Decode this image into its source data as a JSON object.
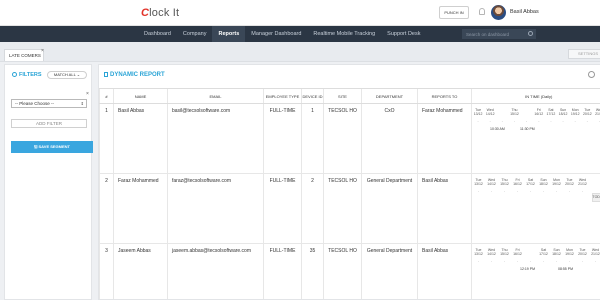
{
  "header": {
    "logo_c": "C",
    "logo_rest": "lock It",
    "punch_label": "PUNCH IN",
    "user_name": "Basil Abbas"
  },
  "nav": {
    "items": [
      {
        "label": "Dashboard"
      },
      {
        "label": "Company"
      },
      {
        "label": "Reports"
      },
      {
        "label": "Manager Dashboard"
      },
      {
        "label": "Realtime Mobile Tracking"
      },
      {
        "label": "Support Desk"
      }
    ],
    "active": "Reports",
    "search_placeholder": "Search on dashboard"
  },
  "tabs": {
    "late_comers": "LATE COMERS",
    "close": "×"
  },
  "filters": {
    "title": "FILTERS",
    "match": "MATCH ALL",
    "close": "×",
    "select_value": "-- Please Choose --",
    "add_filter": "ADD FILTER",
    "save_segment": "SAVE SEGMENT"
  },
  "report": {
    "title": "DYNAMIC REPORT",
    "columns": [
      "#",
      "NAME",
      "EMAIL",
      "EMPLOYEE TYPE",
      "DEVICE ID",
      "SITE",
      "DEPARTMENT",
      "REPORTS TO",
      "IN TIME (Daily)"
    ],
    "rows": [
      {
        "num": "1",
        "name": "Basil Abbas",
        "email": "basil@tecsolsoftware.com",
        "type": "FULL-TIME",
        "device": "1",
        "site": "TECSOL HO",
        "dept": "CxO",
        "reports_to": "Faraz Mohammed",
        "days1": [
          "Tue",
          "Wed",
          "",
          "Thu",
          "",
          "Fri",
          "Sat",
          "Sun",
          "Mon",
          "Tue",
          "Wed"
        ],
        "days2": [
          "13/12",
          "14/12",
          "",
          "15/12",
          "",
          "16/12",
          "17/12",
          "18/12",
          "19/12",
          "20/12",
          "21/12"
        ],
        "times": [
          "10:30 AM",
          "11:30 PM"
        ]
      },
      {
        "num": "2",
        "name": "Faraz Mohammed",
        "email": "faraz@tecsolsoftware.com",
        "type": "FULL-TIME",
        "device": "2",
        "site": "TECSOL HO",
        "dept": "General Department",
        "reports_to": "Basil Abbas",
        "days1": [
          "Tue",
          "Wed",
          "Thu",
          "Fri",
          "Sat",
          "Sun",
          "Mon",
          "Tue",
          "Wed"
        ],
        "days2": [
          "13/12",
          "14/12",
          "15/12",
          "16/12",
          "17/12",
          "18/12",
          "19/12",
          "20/12",
          "21/12"
        ],
        "times": [],
        "today": "TODAY"
      },
      {
        "num": "3",
        "name": "Jaseem Abbas",
        "email": "jaseem.abbas@tecsolsoftware.com",
        "type": "FULL-TIME",
        "device": "35",
        "site": "TECSOL HO",
        "dept": "General Department",
        "reports_to": "Basil Abbas",
        "days1": [
          "Tue",
          "Wed",
          "Thu",
          "Fri",
          "",
          "Sat",
          "Sun",
          "Mon",
          "Tue",
          "Wed"
        ],
        "days2": [
          "13/12",
          "14/12",
          "15/12",
          "16/12",
          "",
          "17/12",
          "18/12",
          "19/12",
          "20/12",
          "21/12"
        ],
        "times": [
          "12:19 PM",
          "08:55 PM"
        ]
      }
    ]
  },
  "settings_label": "SETTINGS"
}
